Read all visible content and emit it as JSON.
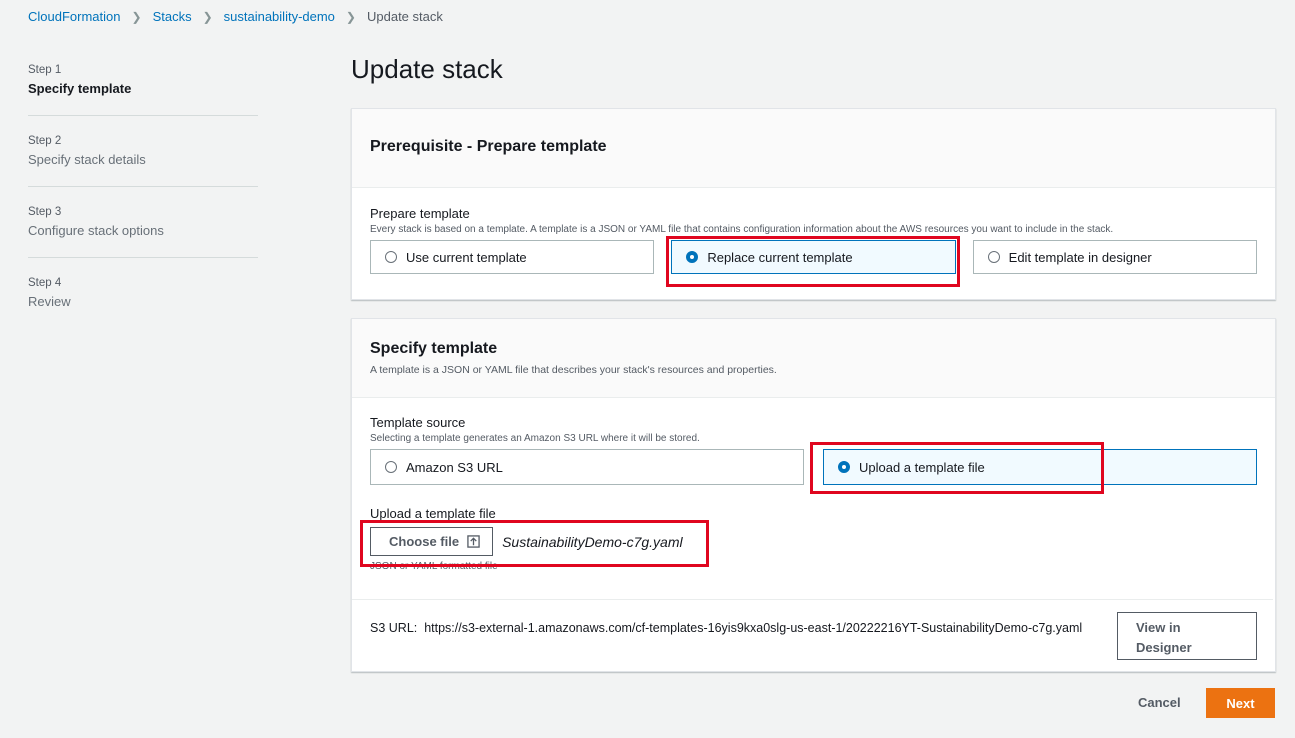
{
  "breadcrumb": {
    "items": [
      "CloudFormation",
      "Stacks",
      "sustainability-demo"
    ],
    "current": "Update stack"
  },
  "steps": [
    {
      "num": "Step 1",
      "title": "Specify template",
      "active": true
    },
    {
      "num": "Step 2",
      "title": "Specify stack details"
    },
    {
      "num": "Step 3",
      "title": "Configure stack options"
    },
    {
      "num": "Step 4",
      "title": "Review"
    }
  ],
  "page_title": "Update stack",
  "prerequisite": {
    "title": "Prerequisite - Prepare template",
    "field_label": "Prepare template",
    "field_desc": "Every stack is based on a template. A template is a JSON or YAML file that contains configuration information about the AWS resources you want to include in the stack.",
    "options": [
      {
        "label": "Use current template",
        "selected": false
      },
      {
        "label": "Replace current template",
        "selected": true
      },
      {
        "label": "Edit template in designer",
        "selected": false
      }
    ]
  },
  "specify": {
    "title": "Specify template",
    "desc": "A template is a JSON or YAML file that describes your stack's resources and properties.",
    "source_label": "Template source",
    "source_desc": "Selecting a template generates an Amazon S3 URL where it will be stored.",
    "sources": [
      {
        "label": "Amazon S3 URL",
        "selected": false
      },
      {
        "label": "Upload a template file",
        "selected": true
      }
    ],
    "upload_label": "Upload a template file",
    "choose_file": "Choose file",
    "file_name": "SustainabilityDemo-c7g.yaml",
    "upload_hint": "JSON or YAML formatted file",
    "s3_label": "S3 URL:",
    "s3_url": "https://s3-external-1.amazonaws.com/cf-templates-16yis9kxa0slg-us-east-1/20222216YT-SustainabilityDemo-c7g.yaml",
    "view_designer_line1": "View in",
    "view_designer_line2": "Designer"
  },
  "actions": {
    "cancel": "Cancel",
    "next": "Next"
  },
  "colors": {
    "accent": "#0073bb",
    "primary": "#ec7211",
    "highlight": "#e0061f"
  }
}
